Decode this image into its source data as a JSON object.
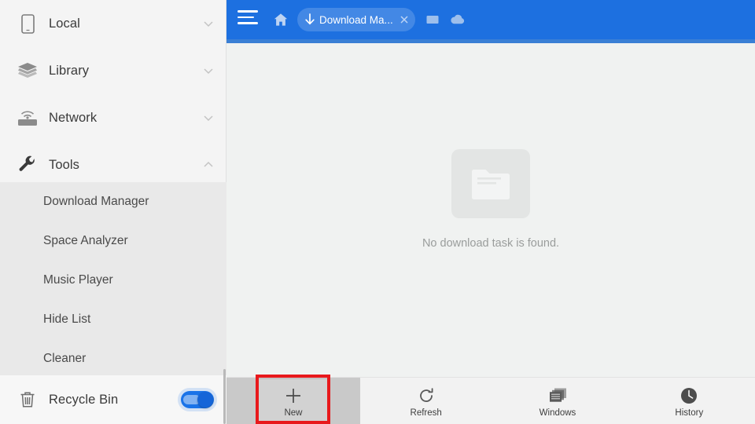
{
  "sidebar": {
    "items": [
      {
        "label": "Local",
        "icon": "phone-icon",
        "chevron": "chevron-down-icon"
      },
      {
        "label": "Library",
        "icon": "layers-icon",
        "chevron": "chevron-down-icon"
      },
      {
        "label": "Network",
        "icon": "router-icon",
        "chevron": "chevron-down-icon"
      },
      {
        "label": "Tools",
        "icon": "wrench-icon",
        "chevron": "chevron-up-icon"
      }
    ],
    "submenu": [
      {
        "label": "Download Manager"
      },
      {
        "label": "Space Analyzer"
      },
      {
        "label": "Music Player"
      },
      {
        "label": "Hide List"
      },
      {
        "label": "Cleaner"
      }
    ],
    "recycle_bin": {
      "label": "Recycle Bin",
      "icon": "trash-icon",
      "toggle_on": true
    }
  },
  "topbar": {
    "menu_icon": "hamburger-icon",
    "home_icon": "home-icon",
    "tab": {
      "icon": "download-arrow-icon",
      "title": "Download Ma...",
      "close_icon": "close-icon"
    },
    "right_icons": [
      {
        "name": "windows-icon"
      },
      {
        "name": "cloud-icon"
      }
    ],
    "accent_color": "#1d70e0"
  },
  "main": {
    "empty_state": {
      "icon": "empty-folder-icon",
      "message": "No download task is found."
    }
  },
  "bottombar": {
    "buttons": [
      {
        "label": "New",
        "icon": "plus-icon"
      },
      {
        "label": "Refresh",
        "icon": "refresh-icon"
      },
      {
        "label": "Windows",
        "icon": "windows-stack-icon"
      },
      {
        "label": "History",
        "icon": "clock-icon"
      }
    ],
    "highlight_color": "#e8191c"
  }
}
